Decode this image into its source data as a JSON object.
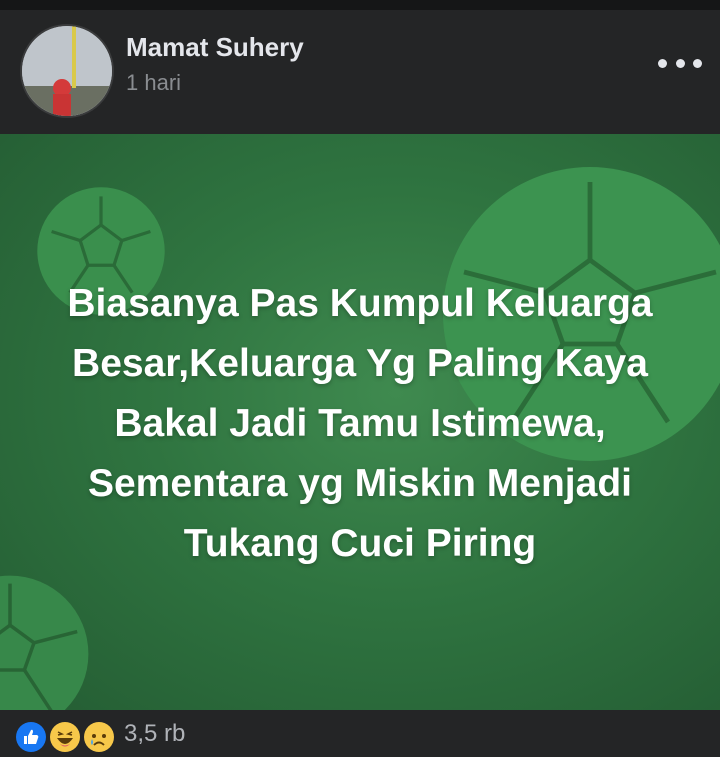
{
  "post": {
    "author": "Mamat Suhery",
    "time": "1 hari",
    "text": "Biasanya Pas Kumpul Keluarga\nBesar,Keluarga Yg Paling Kaya\nBakal Jadi Tamu Istimewa,\nSementara yg Miskin Menjadi\nTukang Cuci Piring",
    "background_color": "#2f7440"
  },
  "reactions": {
    "icons": [
      "like-icon",
      "haha-icon",
      "sad-icon"
    ],
    "count": "3,5 rb"
  },
  "colors": {
    "page_bg": "#242526",
    "text_primary": "#e4e6eb",
    "text_secondary": "#8a8d91",
    "like_blue": "#1877f2",
    "emoji_yellow": "#f7c84a"
  }
}
